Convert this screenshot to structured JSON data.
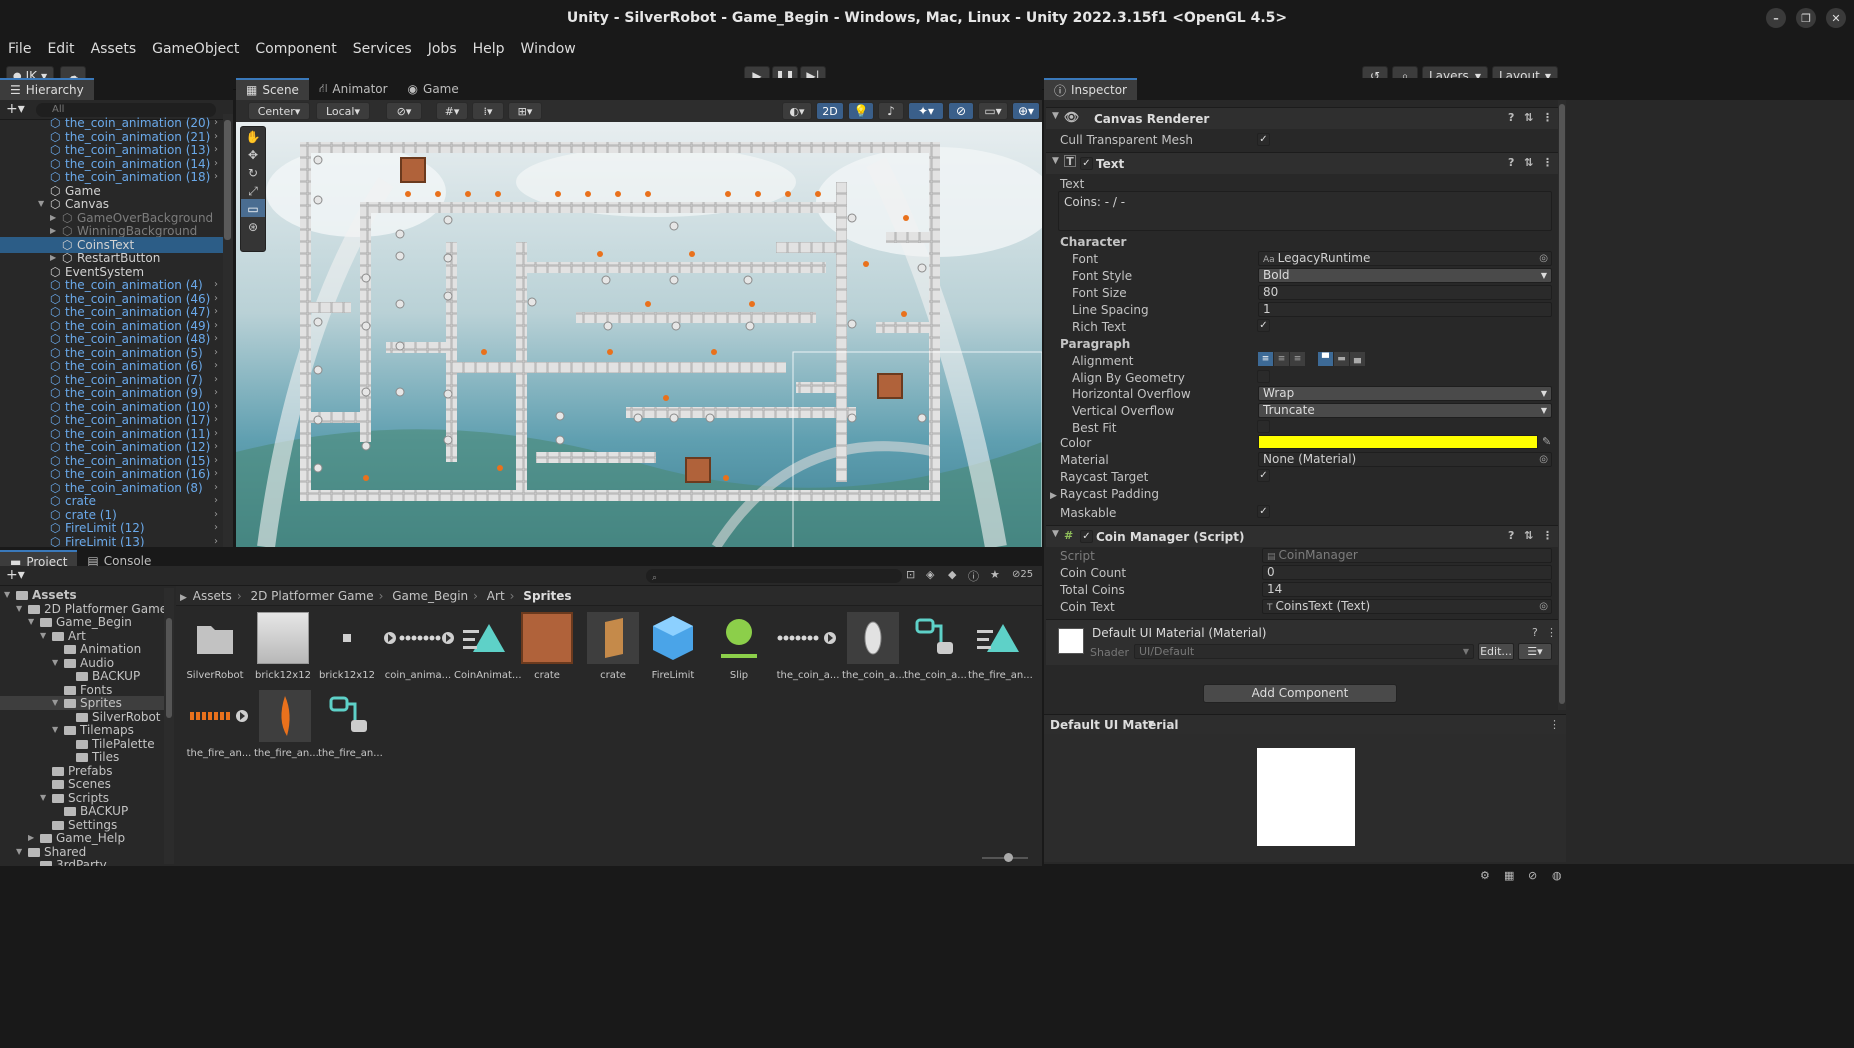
{
  "window": {
    "title": "Unity - SilverRobot - Game_Begin - Windows, Mac, Linux - Unity 2022.3.15f1 <OpenGL 4.5>"
  },
  "menu": [
    "File",
    "Edit",
    "Assets",
    "GameObject",
    "Component",
    "Services",
    "Jobs",
    "Help",
    "Window"
  ],
  "toolbar": {
    "account": "JK",
    "layers": "Layers",
    "layout": "Layout"
  },
  "hierarchy": {
    "tab": "Hierarchy",
    "search_placeholder": "All",
    "rows": [
      {
        "label": "the_coin_animation (20)",
        "indent": 0,
        "style": "blue",
        "arrow": true
      },
      {
        "label": "the_coin_animation (21)",
        "indent": 0,
        "style": "blue",
        "arrow": true
      },
      {
        "label": "the_coin_animation (13)",
        "indent": 0,
        "style": "blue",
        "arrow": true
      },
      {
        "label": "the_coin_animation (14)",
        "indent": 0,
        "style": "blue",
        "arrow": true
      },
      {
        "label": "the_coin_animation (18)",
        "indent": 0,
        "style": "blue",
        "arrow": true
      },
      {
        "label": "Game",
        "indent": 0,
        "style": "white",
        "arrow": false
      },
      {
        "label": "Canvas",
        "indent": 0,
        "style": "white",
        "arrow": false,
        "expand": "down"
      },
      {
        "label": "GameOverBackground",
        "indent": 1,
        "style": "gray",
        "arrow": false,
        "expand": "right"
      },
      {
        "label": "WinningBackground",
        "indent": 1,
        "style": "gray",
        "arrow": false,
        "expand": "right"
      },
      {
        "label": "CoinsText",
        "indent": 1,
        "style": "selected",
        "arrow": false
      },
      {
        "label": "RestartButton",
        "indent": 1,
        "style": "white",
        "arrow": false,
        "expand": "right"
      },
      {
        "label": "EventSystem",
        "indent": 0,
        "style": "white",
        "arrow": false
      },
      {
        "label": "the_coin_animation (4)",
        "indent": 0,
        "style": "blue",
        "arrow": true
      },
      {
        "label": "the_coin_animation (46)",
        "indent": 0,
        "style": "blue",
        "arrow": true
      },
      {
        "label": "the_coin_animation (47)",
        "indent": 0,
        "style": "blue",
        "arrow": true
      },
      {
        "label": "the_coin_animation (49)",
        "indent": 0,
        "style": "blue",
        "arrow": true
      },
      {
        "label": "the_coin_animation (48)",
        "indent": 0,
        "style": "blue",
        "arrow": true
      },
      {
        "label": "the_coin_animation (5)",
        "indent": 0,
        "style": "blue",
        "arrow": true
      },
      {
        "label": "the_coin_animation (6)",
        "indent": 0,
        "style": "blue",
        "arrow": true
      },
      {
        "label": "the_coin_animation (7)",
        "indent": 0,
        "style": "blue",
        "arrow": true
      },
      {
        "label": "the_coin_animation (9)",
        "indent": 0,
        "style": "blue",
        "arrow": true
      },
      {
        "label": "the_coin_animation (10)",
        "indent": 0,
        "style": "blue",
        "arrow": true
      },
      {
        "label": "the_coin_animation (17)",
        "indent": 0,
        "style": "blue",
        "arrow": true
      },
      {
        "label": "the_coin_animation (11)",
        "indent": 0,
        "style": "blue",
        "arrow": true
      },
      {
        "label": "the_coin_animation (12)",
        "indent": 0,
        "style": "blue",
        "arrow": true
      },
      {
        "label": "the_coin_animation (15)",
        "indent": 0,
        "style": "blue",
        "arrow": true
      },
      {
        "label": "the_coin_animation (16)",
        "indent": 0,
        "style": "blue",
        "arrow": true
      },
      {
        "label": "the_coin_animation (8)",
        "indent": 0,
        "style": "blue",
        "arrow": true
      },
      {
        "label": "crate",
        "indent": 0,
        "style": "blue",
        "arrow": true
      },
      {
        "label": "crate (1)",
        "indent": 0,
        "style": "blue",
        "arrow": true
      },
      {
        "label": "FireLimit (12)",
        "indent": 0,
        "style": "blue",
        "arrow": true
      },
      {
        "label": "FireLimit (13)",
        "indent": 0,
        "style": "blue",
        "arrow": true
      }
    ]
  },
  "scene": {
    "tabs": [
      "Scene",
      "Animator",
      "Game"
    ],
    "pivot": "Center",
    "space": "Local",
    "mode2d": "2D"
  },
  "inspector": {
    "tab": "Inspector",
    "canvas_renderer": {
      "title": "Canvas Renderer",
      "cull_label": "Cull Transparent Mesh"
    },
    "text": {
      "title": "Text",
      "text_label": "Text",
      "text_value": "Coins: - / -",
      "character": "Character",
      "font_label": "Font",
      "font_value": "LegacyRuntime",
      "font_style_label": "Font Style",
      "font_style_value": "Bold",
      "font_size_label": "Font Size",
      "font_size_value": "80",
      "line_spacing_label": "Line Spacing",
      "line_spacing_value": "1",
      "rich_text_label": "Rich Text",
      "paragraph": "Paragraph",
      "alignment_label": "Alignment",
      "align_geom_label": "Align By Geometry",
      "h_overflow_label": "Horizontal Overflow",
      "h_overflow_value": "Wrap",
      "v_overflow_label": "Vertical Overflow",
      "v_overflow_value": "Truncate",
      "best_fit_label": "Best Fit",
      "color_label": "Color",
      "color_value": "#ffff00",
      "material_label": "Material",
      "material_value": "None (Material)",
      "raycast_label": "Raycast Target",
      "raycast_padding_label": "Raycast Padding",
      "maskable_label": "Maskable"
    },
    "coin_manager": {
      "title": "Coin Manager (Script)",
      "script_label": "Script",
      "script_value": "CoinManager",
      "coin_count_label": "Coin Count",
      "coin_count_value": "0",
      "total_coins_label": "Total Coins",
      "total_coins_value": "14",
      "coin_text_label": "Coin Text",
      "coin_text_value": "CoinsText (Text)"
    },
    "material": {
      "title": "Default UI Material (Material)",
      "shader_label": "Shader",
      "shader_value": "UI/Default",
      "edit_label": "Edit..."
    },
    "add_component": "Add Component",
    "preview_title": "Default UI Material"
  },
  "project": {
    "tabs": [
      "Project",
      "Console"
    ],
    "breadcrumb": [
      "Assets",
      "2D Platformer Game",
      "Game_Begin",
      "Art",
      "Sprites"
    ],
    "hidden_count": "25",
    "tree": [
      {
        "label": "Assets",
        "indent": 0,
        "bold": true
      },
      {
        "label": "2D Platformer Game",
        "indent": 1
      },
      {
        "label": "Game_Begin",
        "indent": 2
      },
      {
        "label": "Art",
        "indent": 3
      },
      {
        "label": "Animation",
        "indent": 4
      },
      {
        "label": "Audio",
        "indent": 4
      },
      {
        "label": "BACKUP",
        "indent": 5
      },
      {
        "label": "Fonts",
        "indent": 4
      },
      {
        "label": "Sprites",
        "indent": 4,
        "selected": true
      },
      {
        "label": "SilverRobot",
        "indent": 5
      },
      {
        "label": "Tilemaps",
        "indent": 4
      },
      {
        "label": "TilePalette",
        "indent": 5
      },
      {
        "label": "Tiles",
        "indent": 5
      },
      {
        "label": "Prefabs",
        "indent": 3
      },
      {
        "label": "Scenes",
        "indent": 3
      },
      {
        "label": "Scripts",
        "indent": 3
      },
      {
        "label": "BACKUP",
        "indent": 4
      },
      {
        "label": "Settings",
        "indent": 3
      },
      {
        "label": "Game_Help",
        "indent": 2
      },
      {
        "label": "Shared",
        "indent": 1
      },
      {
        "label": "3rdParty",
        "indent": 2
      }
    ],
    "assets": [
      "SilverRobot",
      "brick12x12",
      "brick12x12",
      "coin_anima...",
      "CoinAnimat...",
      "crate",
      "crate",
      "FireLimit",
      "Slip",
      "the_coin_a...",
      "the_coin_a...",
      "the_coin_a...",
      "the_fire_an...",
      "the_fire_an...",
      "the_fire_an...",
      "the_fire_an..."
    ]
  }
}
